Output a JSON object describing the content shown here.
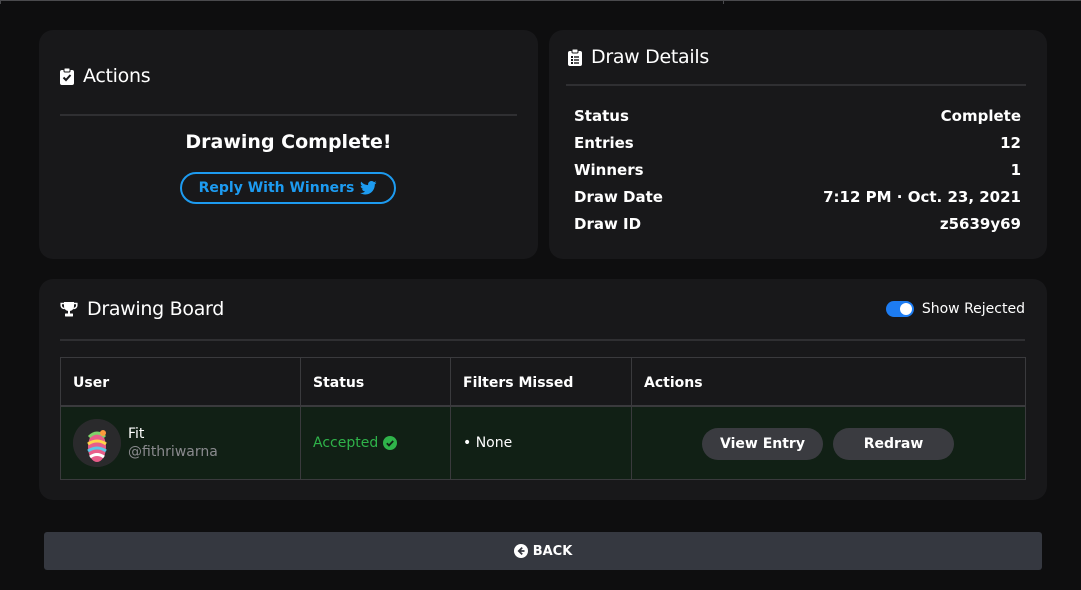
{
  "actions": {
    "title": "Actions",
    "title_icon": "clipboard-check-icon",
    "complete_message": "Drawing Complete!",
    "reply_button_label": "Reply With Winners",
    "reply_icon": "twitter-icon",
    "accent_color": "#1d9bf0"
  },
  "details": {
    "title": "Draw Details",
    "title_icon": "clipboard-list-icon",
    "rows": [
      {
        "label": "Status",
        "value": "Complete"
      },
      {
        "label": "Entries",
        "value": "12"
      },
      {
        "label": "Winners",
        "value": "1"
      },
      {
        "label": "Draw Date",
        "value": "7:12 PM · Oct. 23, 2021"
      },
      {
        "label": "Draw ID",
        "value": "z5639y69"
      }
    ]
  },
  "board": {
    "title": "Drawing Board",
    "title_icon": "trophy-icon",
    "show_rejected_label": "Show Rejected",
    "show_rejected_on": true,
    "columns": [
      "User",
      "Status",
      "Filters Missed",
      "Actions"
    ],
    "entries": [
      {
        "name": "Fit",
        "handle": "@fithriwarna",
        "status": "Accepted",
        "status_color": "#2fb34a",
        "filters_missed": "• None",
        "view_entry_label": "View Entry",
        "redraw_label": "Redraw"
      }
    ]
  },
  "back_button_label": "BACK",
  "back_icon": "arrow-circle-left-icon"
}
